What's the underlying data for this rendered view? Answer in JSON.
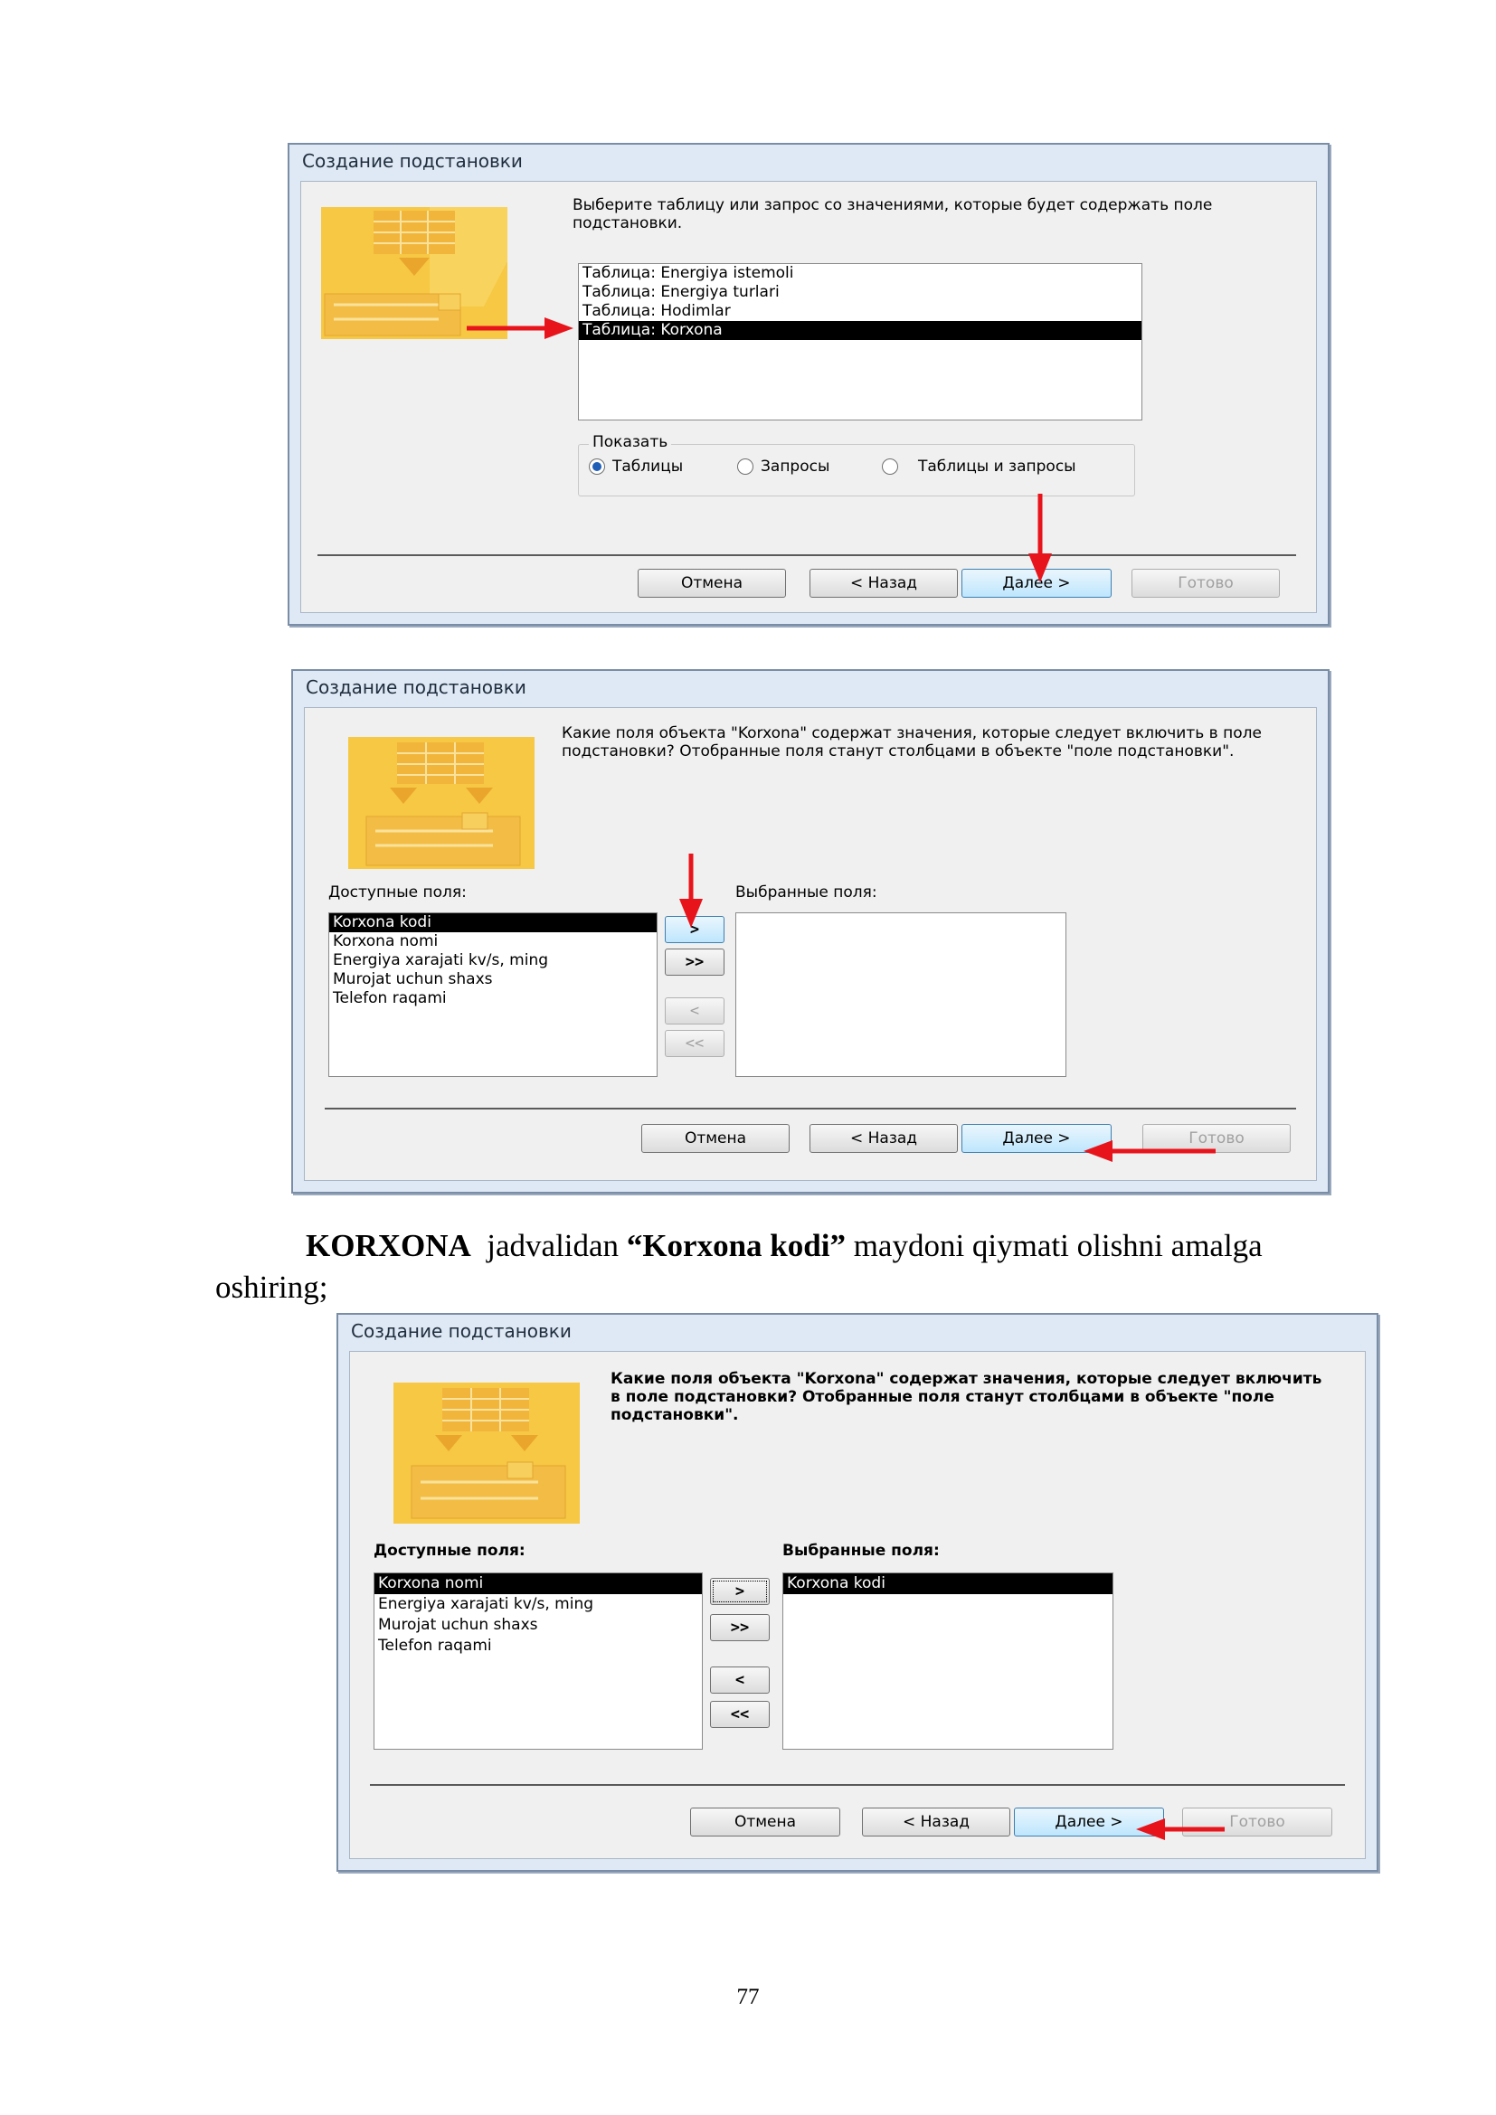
{
  "dialog1": {
    "title": "Создание подстановки",
    "prompt": "Выберите таблицу или запрос со значениями, которые будет содержать поле подстановки.",
    "list_items": [
      "Таблица: Energiya istemoli",
      "Таблица: Energiya turlari",
      "Таблица: Hodimlar",
      "Таблица: Korxona"
    ],
    "selected_index": 3,
    "show_group_label": "Показать",
    "radio_tables": "Таблицы",
    "radio_queries": "Запросы",
    "radio_both": "Таблицы и запросы",
    "cancel": "Отмена",
    "back": "< Назад",
    "next": "Далее >",
    "finish": "Готово"
  },
  "dialog2": {
    "title": "Создание подстановки",
    "prompt": "Какие поля объекта \"Korxona\" содержат значения, которые следует включить в поле подстановки? Отобранные поля станут столбцами в объекте \"поле подстановки\".",
    "available_label": "Доступные поля:",
    "selected_label": "Выбранные поля:",
    "available_fields": [
      "Korxona kodi",
      "Korxona nomi",
      "Energiya xarajati kv/s, ming",
      "Murojat uchun shaxs",
      "Telefon raqami"
    ],
    "selected_fields": [],
    "btn_add": ">",
    "btn_add_all": ">>",
    "btn_remove": "<",
    "btn_remove_all": "<<",
    "cancel": "Отмена",
    "back": "< Назад",
    "next": "Далее >",
    "finish": "Готово"
  },
  "paragraph": {
    "bold1": "KORXONA",
    "text1": "  jadvalidan ",
    "bold2": "“Korxona kodi”",
    "text2": " maydoni qiymati olishni amalga",
    "line2": "oshiring;"
  },
  "dialog3": {
    "title": "Создание подстановки",
    "prompt": "Какие поля объекта \"Korxona\" содержат значения, которые следует включить в поле подстановки? Отобранные поля станут столбцами в объекте \"поле подстановки\".",
    "available_label": "Доступные поля:",
    "selected_label": "Выбранные поля:",
    "available_fields": [
      "Korxona nomi",
      "Energiya xarajati kv/s, ming",
      "Murojat uchun shaxs",
      "Telefon raqami"
    ],
    "selected_fields": [
      "Korxona kodi"
    ],
    "btn_add": ">",
    "btn_add_all": ">>",
    "btn_remove": "<",
    "btn_remove_all": "<<",
    "cancel": "Отмена",
    "back": "< Назад",
    "next": "Далее >",
    "finish": "Готово"
  },
  "page_number": "77",
  "colors": {
    "highlight_arrow": "#e8141b",
    "wizard_icon": "#f6c843",
    "selection": "#000000"
  }
}
